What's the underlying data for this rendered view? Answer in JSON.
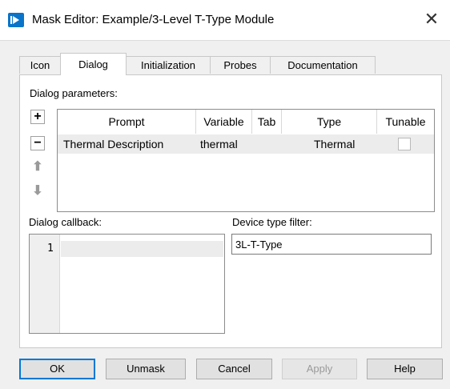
{
  "window": {
    "title": "Mask Editor: Example/3-Level T-Type Module",
    "icon": "simulink-icon",
    "close_glyph": "✕"
  },
  "tabs": [
    {
      "label": "Icon",
      "active": false
    },
    {
      "label": "Dialog",
      "active": true
    },
    {
      "label": "Initialization",
      "active": false
    },
    {
      "label": "Probes",
      "active": false
    },
    {
      "label": "Documentation",
      "active": false
    }
  ],
  "dialog_parameters": {
    "label": "Dialog parameters:",
    "buttons": [
      {
        "name": "add",
        "glyph": "+",
        "enabled": true
      },
      {
        "name": "remove",
        "glyph": "−",
        "enabled": true
      },
      {
        "name": "move-up",
        "glyph": "⬆",
        "enabled": false
      },
      {
        "name": "move-down",
        "glyph": "⬇",
        "enabled": false
      }
    ],
    "columns": [
      "Prompt",
      "Variable",
      "Tab",
      "Type",
      "Tunable"
    ],
    "rows": [
      {
        "prompt": "Thermal Description",
        "variable": "thermal",
        "tab": "",
        "type": "Thermal",
        "tunable": false
      }
    ]
  },
  "dialog_callback": {
    "label": "Dialog callback:",
    "line_numbers": [
      "1"
    ],
    "code": ""
  },
  "device_type_filter": {
    "label": "Device type filter:",
    "value": "3L-T-Type"
  },
  "footer_buttons": {
    "ok": "OK",
    "unmask": "Unmask",
    "cancel": "Cancel",
    "apply": "Apply",
    "help": "Help"
  },
  "colors": {
    "accent": "#0078d7",
    "title_icon": "#0a74c9",
    "selected_row": "#ececec"
  }
}
